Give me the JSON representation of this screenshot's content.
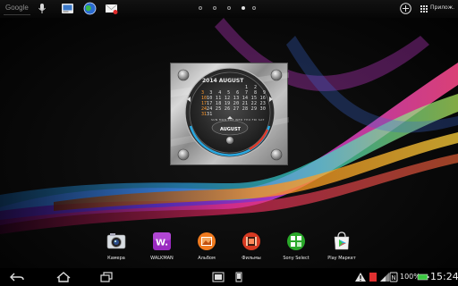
{
  "search": {
    "label": "Google"
  },
  "apps_button": {
    "label": "Прилож."
  },
  "home_pages": {
    "count": 5,
    "active_index": 3
  },
  "calendar_widget": {
    "header": "2014  AUGUST",
    "rows": [
      "             1  2",
      " 3  4  5  6  7  8  9",
      "10 11 12 13 14 15 16",
      "17 18 19 20 21 22 23",
      "24 25 26 27 28 29 30",
      "31"
    ],
    "side_weeks": [
      "3",
      "10",
      "17",
      "24",
      "31"
    ],
    "weekdays": "SUN MON TUE WED THU FRI SAT",
    "month_badge": "AUGUST"
  },
  "dock": [
    {
      "label": "Камера",
      "icon": "camera-icon",
      "color": "#cfd8e0"
    },
    {
      "label": "WALKMAN",
      "icon": "walkman-icon",
      "color": "#b03ac8"
    },
    {
      "label": "Альбом",
      "icon": "album-icon",
      "color": "#f07a1e"
    },
    {
      "label": "Фильмы",
      "icon": "movies-icon",
      "color": "#e04a2a"
    },
    {
      "label": "Sony Select",
      "icon": "sony-select-icon",
      "color": "#2ea82e"
    },
    {
      "label": "Play Маркет",
      "icon": "play-store-icon",
      "color": "#e8e8e8"
    }
  ],
  "status": {
    "battery": "100%",
    "time": "15:24"
  }
}
